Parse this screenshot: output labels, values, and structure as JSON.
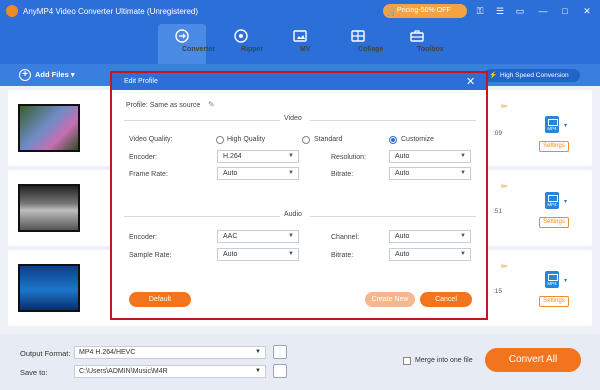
{
  "app": {
    "title": "AnyMP4 Video Converter Ultimate (Unregistered)",
    "pricing": "Pricing-50% OFF"
  },
  "nav": {
    "tabs": [
      {
        "label": "Converter",
        "icon": "converter-icon"
      },
      {
        "label": "Ripper",
        "icon": "ripper-icon"
      },
      {
        "label": "MV",
        "icon": "mv-icon"
      },
      {
        "label": "Collage",
        "icon": "collage-icon"
      },
      {
        "label": "Toolbox",
        "icon": "toolbox-icon"
      }
    ]
  },
  "toolbar": {
    "add_files": "Add Files",
    "high_speed": "High Speed Conversion"
  },
  "files": [
    {
      "time_fragment": ":09",
      "format": "MP4",
      "settings": "Settings"
    },
    {
      "time_fragment": ":51",
      "format": "MP4",
      "settings": "Settings"
    },
    {
      "time_fragment": ":15",
      "format": "MP4",
      "settings": "Settings"
    }
  ],
  "dialog": {
    "title": "Edit Profile",
    "profile": "Profile:  Same as source",
    "video_section": "Video",
    "audio_section": "Audio",
    "video_quality_label": "Video Quality:",
    "quality_options": [
      "High Quality",
      "Standard",
      "Customize"
    ],
    "quality_selected": "Customize",
    "encoder_label": "Encoder:",
    "encoder_value": "H.264",
    "resolution_label": "Resolution:",
    "resolution_value": "Auto",
    "frame_rate_label": "Frame Rate:",
    "frame_rate_value": "Auto",
    "bitrate_label": "Bitrate:",
    "bitrate_value": "Auto",
    "audio_encoder_label": "Encoder:",
    "audio_encoder_value": "AAC",
    "channel_label": "Channel:",
    "channel_value": "Auto",
    "sample_rate_label": "Sample Rate:",
    "sample_rate_value": "Auto",
    "audio_bitrate_label": "Bitrate:",
    "audio_bitrate_value": "Auto",
    "default_btn": "Default",
    "create_btn": "Create New",
    "cancel_btn": "Cancel"
  },
  "bottom": {
    "output_format_label": "Output Format:",
    "output_format_value": "MP4 H.264/HEVC",
    "save_to_label": "Save to:",
    "save_to_value": "C:\\Users\\ADMIN\\Music\\M4R",
    "merge_label": "Merge into one file",
    "convert_all": "Convert All"
  },
  "colors": {
    "brand_blue": "#2c6fd8",
    "accent_orange": "#f2741f",
    "highlight_red": "#c5161d"
  }
}
